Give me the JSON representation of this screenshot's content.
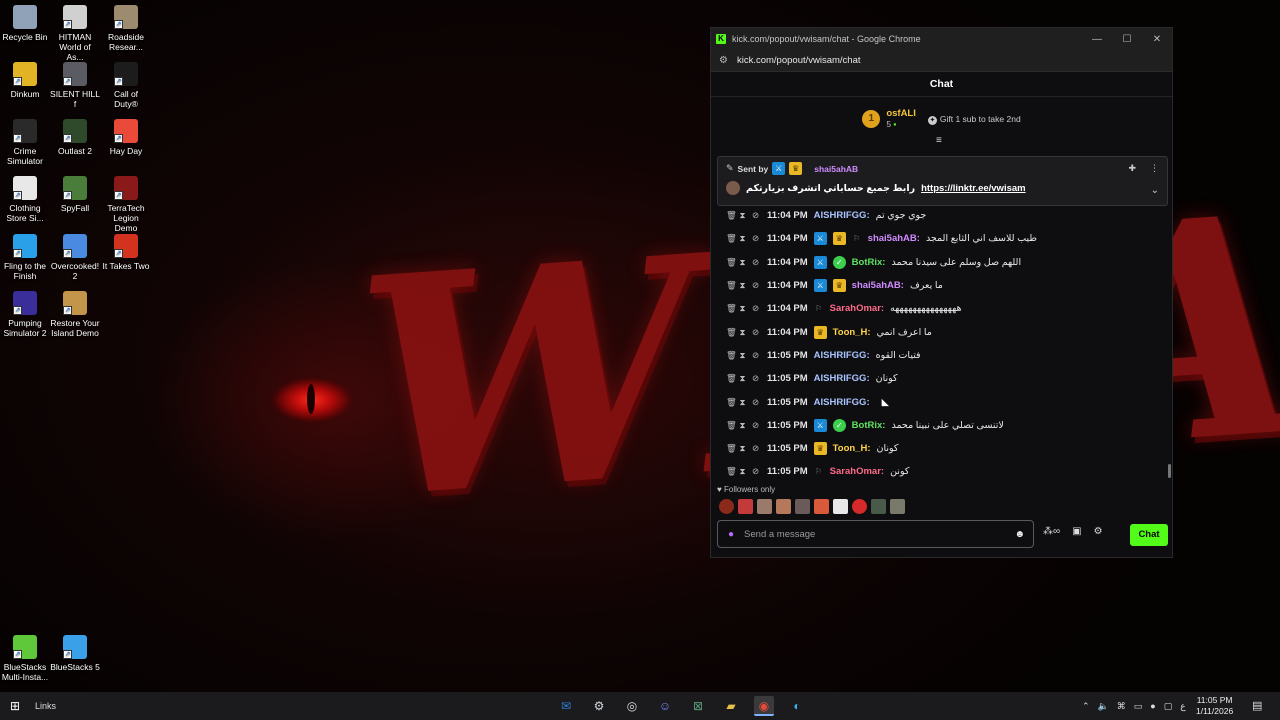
{
  "wallpaper": {
    "text": "WISA"
  },
  "desktop_icons": [
    {
      "label": "Recycle Bin",
      "icon": "recycle-bin-icon",
      "color": "#8fa2b8"
    },
    {
      "label": "HITMAN World of As...",
      "icon": "hitman-icon",
      "color": "#d0d0d0"
    },
    {
      "label": "Roadside Resear...",
      "icon": "roadside-research-icon",
      "color": "#9c8b6e"
    },
    {
      "label": "Dinkum",
      "icon": "dinkum-icon",
      "color": "#e3b326"
    },
    {
      "label": "SILENT HILL f",
      "icon": "silent-hill-icon",
      "color": "#5b5b63"
    },
    {
      "label": "Call of Duty®",
      "icon": "call-of-duty-icon",
      "color": "#1c1c1c"
    },
    {
      "label": "Crime Simulator",
      "icon": "crime-simulator-icon",
      "color": "#2a2a2a"
    },
    {
      "label": "Outlast 2",
      "icon": "outlast-icon",
      "color": "#2f4a2a"
    },
    {
      "label": "Hay Day",
      "icon": "hay-day-icon",
      "color": "#e94a3a"
    },
    {
      "label": "Clothing Store Si...",
      "icon": "clothing-store-icon",
      "color": "#e8e8e8"
    },
    {
      "label": "SpyFall",
      "icon": "spyfall-icon",
      "color": "#4a7c3a"
    },
    {
      "label": "TerraTech Legion Demo",
      "icon": "terratech-icon",
      "color": "#8a1a1a"
    },
    {
      "label": "Fling to the Finish",
      "icon": "fling-icon",
      "color": "#2aa0e8"
    },
    {
      "label": "Overcooked! 2",
      "icon": "overcooked-icon",
      "color": "#4a8ae0"
    },
    {
      "label": "It Takes Two",
      "icon": "it-takes-two-icon",
      "color": "#d3321e"
    },
    {
      "label": "Pumping Simulator 2",
      "icon": "pumping-sim-icon",
      "color": "#3a2f9a"
    },
    {
      "label": "Restore Your Island Demo",
      "icon": "restore-island-icon",
      "color": "#c2954a"
    },
    {
      "label": "BlueStacks Multi-Insta...",
      "icon": "bluestacks-multi-icon",
      "color": "#5ec83a"
    },
    {
      "label": "BlueStacks 5",
      "icon": "bluestacks-icon",
      "color": "#3aa0e8"
    }
  ],
  "browser": {
    "title": "kick.com/popout/vwisam/chat - Google Chrome",
    "url": "kick.com/popout/vwisam/chat",
    "minimize": "—",
    "maximize": "☐",
    "close": "✕"
  },
  "chat": {
    "header": "Chat",
    "leader": {
      "rank": "1",
      "name": "osfALI",
      "count": "5",
      "gift_text": "Gift 1 sub to take 2nd"
    },
    "pinned": {
      "sent_by": "Sent by",
      "author": "shai5ahAB",
      "message": "رابط جميع حساباتي اتشرف بزيارتكم",
      "link": "https://linktr.ee/vwisam"
    },
    "messages": [
      {
        "time": "11:04 PM",
        "user": "AISHRIFGG",
        "user_color": "#a9c4ff",
        "text": "جوي جوي تم",
        "badges": []
      },
      {
        "time": "11:04 PM",
        "user": "shai5ahAB",
        "user_color": "#d08cff",
        "text": "طيب للاسف اني الثابع المجد",
        "badges": [
          "mod",
          "crown",
          "sub"
        ]
      },
      {
        "time": "11:04 PM",
        "user": "BotRix",
        "user_color": "#5ee35e",
        "text": "اللهم صل وسلم على سيدنا محمد",
        "badges": [
          "mod",
          "verified"
        ]
      },
      {
        "time": "11:04 PM",
        "user": "shai5ahAB",
        "user_color": "#d08cff",
        "text": "ما يعرف",
        "badges": [
          "mod",
          "crown"
        ]
      },
      {
        "time": "11:04 PM",
        "user": "SarahOmar",
        "user_color": "#ff6b8a",
        "text": "هههههههههههههههه",
        "badges": [
          "sub"
        ]
      },
      {
        "time": "11:04 PM",
        "user": "Toon_H",
        "user_color": "#ffd54a",
        "text": "ما اعرف انمي",
        "badges": [
          "crown"
        ]
      },
      {
        "time": "11:05 PM",
        "user": "AISHRIFGG",
        "user_color": "#a9c4ff",
        "text": "فتيات القوه",
        "badges": []
      },
      {
        "time": "11:05 PM",
        "user": "AISHRIFGG",
        "user_color": "#a9c4ff",
        "text": "كونان",
        "badges": []
      },
      {
        "time": "11:05 PM",
        "user": "AISHRIFGG",
        "user_color": "#a9c4ff",
        "text": "",
        "badges": []
      },
      {
        "time": "11:05 PM",
        "user": "BotRix",
        "user_color": "#5ee35e",
        "text": "لاتنسى تصلي على نبينا محمد",
        "badges": [
          "mod",
          "verified"
        ]
      },
      {
        "time": "11:05 PM",
        "user": "Toon_H",
        "user_color": "#ffd54a",
        "text": "كونان",
        "badges": [
          "crown"
        ]
      },
      {
        "time": "11:05 PM",
        "user": "SarahOmar",
        "user_color": "#ff6b8a",
        "text": "كونن",
        "badges": [
          "sub"
        ]
      }
    ],
    "followers_only": "Followers only",
    "composer_placeholder": "Send a message",
    "send_label": "Chat",
    "accent": "#53fc18"
  },
  "taskbar": {
    "links_label": "Links",
    "apps": [
      "outlook-icon",
      "steam-icon",
      "obs-icon",
      "discord-icon",
      "xbox-icon",
      "file-explorer-icon",
      "chrome-icon",
      "edge-icon"
    ],
    "time": "11:05 PM",
    "date": "1/11/2026",
    "lang": "ع"
  }
}
